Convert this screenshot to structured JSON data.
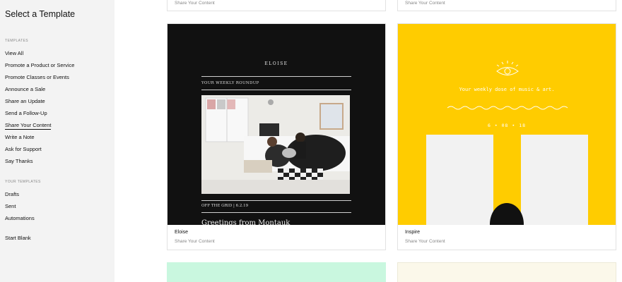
{
  "sidebar": {
    "title": "Select a Template",
    "templates_label": "TEMPLATES",
    "items": [
      {
        "label": "View All"
      },
      {
        "label": "Promote a Product or Service"
      },
      {
        "label": "Promote Classes or Events"
      },
      {
        "label": "Announce a Sale"
      },
      {
        "label": "Share an Update"
      },
      {
        "label": "Send a Follow-Up"
      },
      {
        "label": "Share Your Content"
      },
      {
        "label": "Write a Note"
      },
      {
        "label": "Ask for Support"
      },
      {
        "label": "Say Thanks"
      }
    ],
    "your_templates_label": "YOUR TEMPLATES",
    "your_items": [
      {
        "label": "Drafts"
      },
      {
        "label": "Sent"
      },
      {
        "label": "Automations"
      }
    ],
    "start_blank": "Start Blank"
  },
  "cards": {
    "top_left": {
      "category": "Share Your Content"
    },
    "top_right": {
      "category": "Share Your Content"
    },
    "eloise": {
      "name": "Eloise",
      "category": "Share Your Content",
      "preview": {
        "brand": "ELOISE",
        "kicker": "YOUR WEEKLY ROUNDUP",
        "caption": "OFF THE GRID | 6.2.19",
        "headline": "Greetings from Montauk"
      }
    },
    "inspire": {
      "name": "Inspire",
      "category": "Share Your Content",
      "preview": {
        "tagline": "Your weekly dose of music & art.",
        "date": "6 • 08 • 18"
      }
    }
  },
  "colors": {
    "eloise_bg": "#111111",
    "inspire_bg": "#ffcc00",
    "mint_card": "#c9f7df",
    "cream_card": "#fbf8ea"
  }
}
